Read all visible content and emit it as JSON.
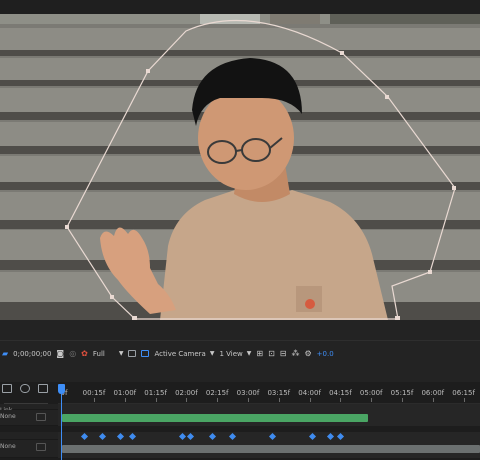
{
  "viewer": {
    "timecode": "0;00;00;00",
    "resolution": "Full",
    "camera": "Active Camera",
    "views": "1 View",
    "exposure": "+0.0"
  },
  "timeline": {
    "ruler_labels": [
      "00:15f",
      "01:00f",
      "01:15f",
      "02:00f",
      "02:15f",
      "03:00f",
      "03:15f",
      "04:00f",
      "04:15f",
      "05:00f",
      "05:15f",
      "06:00f",
      "06:15f"
    ],
    "first_label": "0f",
    "layers": [
      {
        "name": "Link",
        "mode": ""
      },
      {
        "name": "None",
        "mode": "v"
      },
      {
        "name": "",
        "mode": ""
      },
      {
        "name": "None",
        "mode": "v"
      }
    ]
  },
  "colors": {
    "accent": "#3e8ef7",
    "layer_bar_green": "#4aa564",
    "layer_bar_gray": "#6b7070",
    "mask_path": "#e9d9d2"
  },
  "icons": [
    "camera-icon",
    "snapshot-icon",
    "color-channel-icon",
    "region-icon",
    "transparency-grid-icon",
    "roi-icon",
    "grid-guides-icon",
    "3d-view-icon",
    "fast-previews-icon",
    "exposure-reset-icon",
    "comp-marker-icon",
    "comp-flowchart-icon"
  ]
}
